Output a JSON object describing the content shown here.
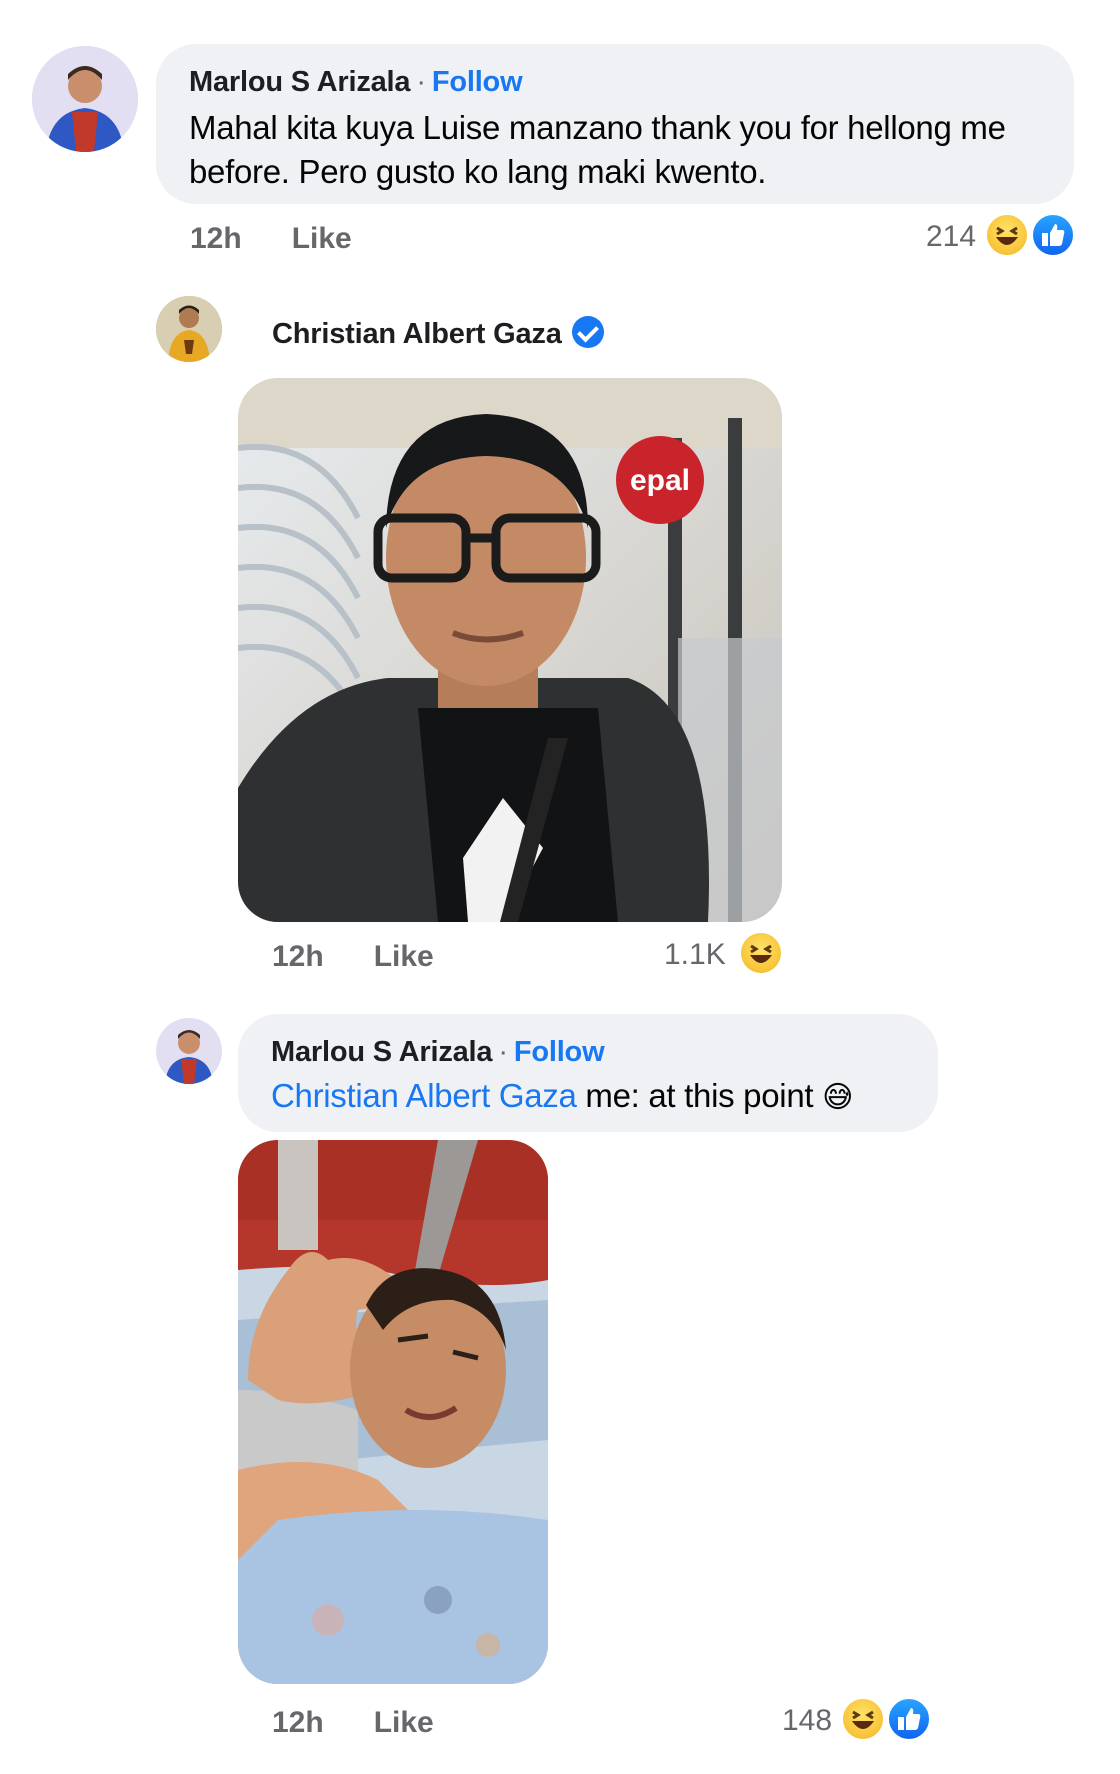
{
  "comments": [
    {
      "author": "Marlou S Arizala",
      "separator": "·",
      "follow_label": "Follow",
      "text_line1": "Mahal kita kuya Luise manzano thank you for hellong me",
      "text_line2": "before. Pero gusto ko lang maki kwento.",
      "time": "12h",
      "like_label": "Like",
      "reaction_count": "214",
      "reactions": [
        "haha-icon",
        "like-icon"
      ]
    },
    {
      "author": "Christian Albert Gaza",
      "verified": true,
      "photo_sign": "epal",
      "time": "12h",
      "like_label": "Like",
      "reaction_count": "1.1K",
      "reactions": [
        "haha-icon"
      ]
    },
    {
      "author": "Marlou S Arizala",
      "separator": "·",
      "follow_label": "Follow",
      "mention": "Christian Albert Gaza",
      "text": " me: at this point",
      "emoji": "😅",
      "time": "12h",
      "like_label": "Like",
      "reaction_count": "148",
      "reactions": [
        "haha-icon",
        "like-icon"
      ]
    }
  ],
  "colors": {
    "link": "#1877f2",
    "bubble": "#eff1f4",
    "meta": "#65676b"
  }
}
